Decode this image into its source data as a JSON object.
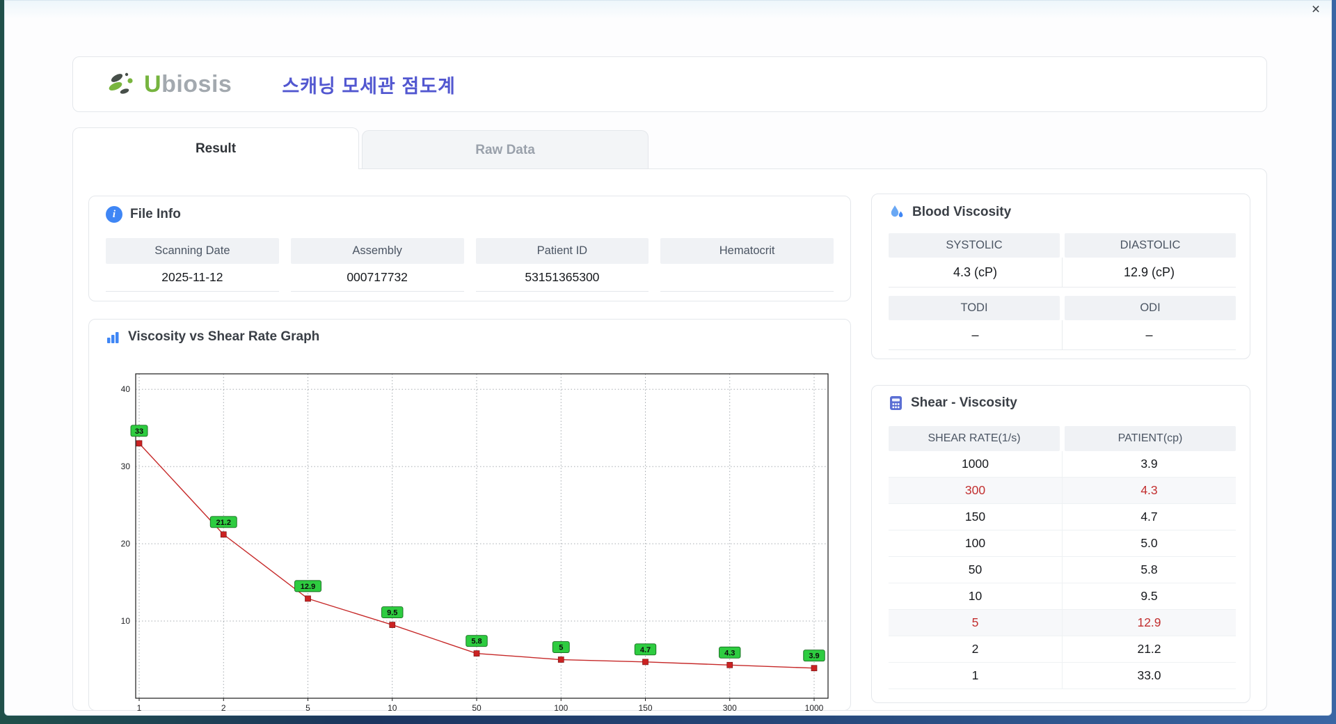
{
  "window": {
    "close_icon": "×"
  },
  "header": {
    "logo_u": "U",
    "logo_rest": "biosis",
    "title": "스캐닝 모세관 점도계",
    "brand_green": "#76b43f",
    "title_color": "#5257d0"
  },
  "tabs": [
    {
      "label": "Result",
      "active": true
    },
    {
      "label": "Raw Data",
      "active": false
    }
  ],
  "file_info": {
    "title": "File Info",
    "fields": [
      {
        "label": "Scanning Date",
        "value": "2025-11-12"
      },
      {
        "label": "Assembly",
        "value": "000717732"
      },
      {
        "label": "Patient ID",
        "value": "53151365300"
      },
      {
        "label": "Hematocrit",
        "value": ""
      }
    ]
  },
  "blood_viscosity": {
    "title": "Blood Viscosity",
    "sections": [
      {
        "labels": [
          "SYSTOLIC",
          "DIASTOLIC"
        ],
        "values": [
          "4.3 (cP)",
          "12.9 (cP)"
        ]
      },
      {
        "labels": [
          "TODI",
          "ODI"
        ],
        "values": [
          "–",
          "–"
        ]
      }
    ]
  },
  "shear_viscosity": {
    "title": "Shear - Viscosity",
    "columns": [
      "SHEAR RATE(1/s)",
      "PATIENT(cp)"
    ],
    "highlight_color": "#c22f2f",
    "rows": [
      {
        "rate": "1000",
        "value": "3.9",
        "highlight": false
      },
      {
        "rate": "300",
        "value": "4.3",
        "highlight": true
      },
      {
        "rate": "150",
        "value": "4.7",
        "highlight": false
      },
      {
        "rate": "100",
        "value": "5.0",
        "highlight": false
      },
      {
        "rate": "50",
        "value": "5.8",
        "highlight": false
      },
      {
        "rate": "10",
        "value": "9.5",
        "highlight": false
      },
      {
        "rate": "5",
        "value": "12.9",
        "highlight": true
      },
      {
        "rate": "2",
        "value": "21.2",
        "highlight": false
      },
      {
        "rate": "1",
        "value": "33.0",
        "highlight": false
      }
    ]
  },
  "chart_data": {
    "type": "line",
    "title": "Viscosity vs Shear Rate Graph",
    "x": [
      1,
      2,
      5,
      10,
      50,
      100,
      150,
      300,
      1000
    ],
    "values": [
      33,
      21.2,
      12.9,
      9.5,
      5.8,
      5,
      4.7,
      4.3,
      3.9
    ],
    "labels": [
      "33",
      "21.2",
      "12.9",
      "9.5",
      "5.8",
      "5",
      "4.7",
      "4.3",
      "3.9"
    ],
    "x_ticks": [
      "1",
      "2",
      "5",
      "10",
      "50",
      "100",
      "150",
      "300",
      "1000"
    ],
    "y_ticks": [
      10,
      20,
      30,
      40
    ],
    "ylim": [
      0,
      42
    ],
    "xlabel": "",
    "ylabel": "",
    "grid": "dotted",
    "legend": "none",
    "line_color": "#c62828",
    "marker_color": "#cc2222",
    "label_bg": "#2ecc40"
  }
}
